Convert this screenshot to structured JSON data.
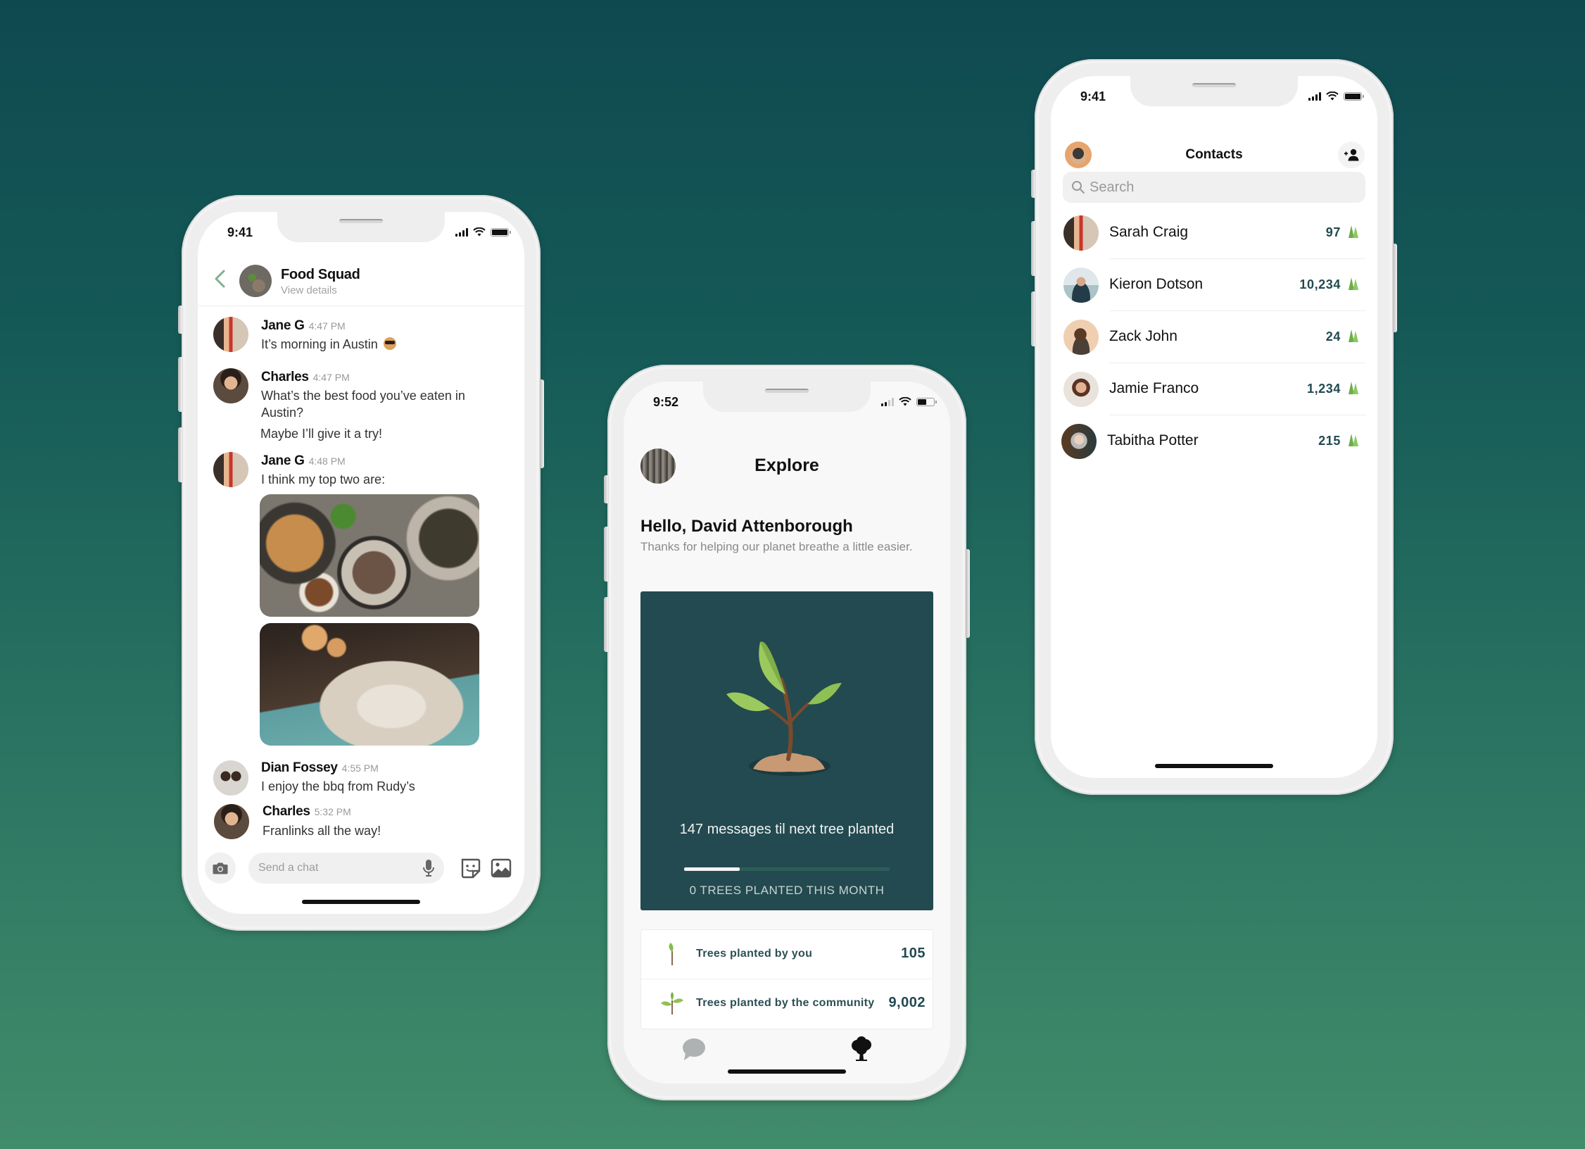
{
  "colors": {
    "background_top": "#0f4950",
    "background_bottom": "#418c6b",
    "tree_card": "#224a50",
    "stat_text": "#214a50",
    "back_arrow": "#7fb08f"
  },
  "chat_screen": {
    "status": {
      "time": "9:41"
    },
    "header": {
      "title": "Food Squad",
      "subtitle": "View details"
    },
    "messages": [
      {
        "sender": "Jane G",
        "time": "4:47 PM",
        "text": "It’s morning in Austin",
        "emoji": "smiling-face-with-sunglasses"
      },
      {
        "sender": "Charles",
        "time": "4:47 PM",
        "text": "What’s the best food you’ve eaten in Austin?",
        "followup": "Maybe I’ll give it a try!"
      },
      {
        "sender": "Jane G",
        "time": "4:48 PM",
        "text": "I think my top two are:",
        "images": [
          "food-photo-plates",
          "food-photo-grilled-corn"
        ]
      },
      {
        "sender": "Dian Fossey",
        "time": "4:55 PM",
        "text": "I enjoy the bbq from Rudy’s"
      },
      {
        "sender": "Charles",
        "time": "5:32 PM",
        "text": "Franlinks all the way!"
      }
    ],
    "composer": {
      "placeholder": "Send a chat",
      "value": ""
    }
  },
  "explore_screen": {
    "status": {
      "time": "9:52"
    },
    "title": "Explore",
    "greeting": "Hello, David Attenborough",
    "greeting_sub": "Thanks for helping our planet breathe a little easier.",
    "tree_card": {
      "message": "147 messages til next tree planted",
      "progress_fraction": 0.27,
      "count_label": "0 TREES PLANTED THIS MONTH"
    },
    "stats": [
      {
        "icon": "sapling-icon",
        "label": "Trees planted by you",
        "value": "105"
      },
      {
        "icon": "seedling-icon",
        "label": "Trees planted by the community",
        "value": "9,002"
      }
    ],
    "tabs": [
      {
        "name": "chats",
        "icon": "chat-bubble-icon",
        "active": false
      },
      {
        "name": "explore",
        "icon": "tree-icon",
        "active": true
      }
    ]
  },
  "contacts_screen": {
    "status": {
      "time": "9:41"
    },
    "title": "Contacts",
    "search": {
      "placeholder": "Search",
      "value": ""
    },
    "contacts": [
      {
        "name": "Sarah Craig",
        "trees": "97"
      },
      {
        "name": "Kieron Dotson",
        "trees": "10,234"
      },
      {
        "name": "Zack John",
        "trees": "24"
      },
      {
        "name": "Jamie Franco",
        "trees": "1,234"
      },
      {
        "name": "Tabitha Potter",
        "trees": "215"
      }
    ]
  }
}
